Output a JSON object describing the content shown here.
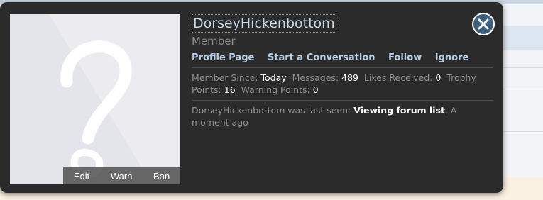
{
  "profile": {
    "username": "DorseyHickenbottom",
    "user_title": "Member",
    "links": {
      "profile_page": "Profile Page",
      "start_conversation": "Start a Conversation",
      "follow": "Follow",
      "ignore": "Ignore"
    },
    "stats": {
      "member_since_label": "Member Since:",
      "member_since_value": "Today",
      "messages_label": "Messages:",
      "messages_value": "489",
      "likes_label": "Likes Received:",
      "likes_value": "0",
      "trophy_label": "Trophy Points:",
      "trophy_value": "16",
      "warning_label": "Warning Points:",
      "warning_value": "0"
    },
    "last_seen": {
      "prefix": "DorseyHickenbottom was last seen:",
      "activity": "Viewing forum list",
      "time": "A moment ago"
    },
    "moderation": {
      "edit": "Edit",
      "warn": "Warn",
      "ban": "Ban"
    }
  },
  "icons": {
    "close": "close-icon",
    "avatar": "default-avatar-question-mark"
  }
}
